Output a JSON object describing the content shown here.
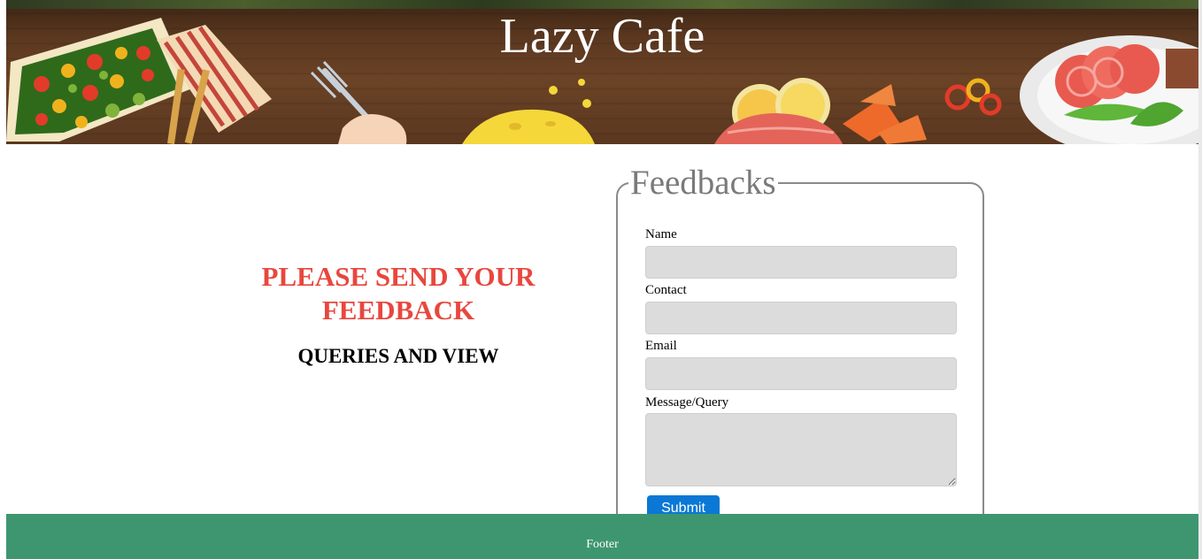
{
  "header": {
    "title": "Lazy Cafe"
  },
  "promo": {
    "heading": "PLEASE SEND YOUR FEEDBACK",
    "subheading": "QUERIES AND VIEW"
  },
  "feedback_form": {
    "legend": "Feedbacks",
    "fields": [
      {
        "label": "Name",
        "value": "",
        "placeholder": ""
      },
      {
        "label": "Contact",
        "value": "",
        "placeholder": ""
      },
      {
        "label": "Email",
        "value": "",
        "placeholder": ""
      },
      {
        "label": "Message/Query",
        "value": "",
        "placeholder": ""
      }
    ],
    "submit_label": "Submit"
  },
  "footer": {
    "text": "Footer"
  },
  "colors": {
    "banner_wood": "#5a371f",
    "promo_heading": "#e8473e",
    "input_background": "#dcdcdc",
    "submit_button": "#0a78d4",
    "footer_background": "#3e9670",
    "legend_text": "#7a7a7a"
  },
  "icons": {
    "banner_decor": [
      "salad-plate-illustration",
      "fork-in-hand-illustration",
      "cheese-illustration",
      "citrus-slices-illustration",
      "salmon-illustration",
      "carrot-illustration",
      "meat-plate-illustration"
    ],
    "textarea_resize": "resize-grip-icon"
  }
}
